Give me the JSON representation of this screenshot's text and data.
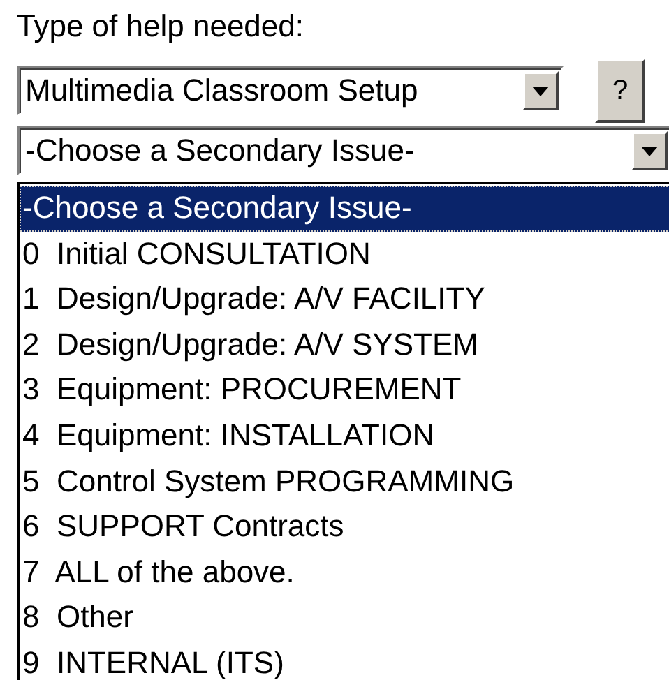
{
  "label": "Type of help needed:",
  "primary_select": {
    "value": "Multimedia Classroom Setup"
  },
  "help_button": {
    "label": "?"
  },
  "secondary_select": {
    "value": "-Choose a Secondary Issue-"
  },
  "options": [
    {
      "label": "-Choose a Secondary Issue-",
      "selected": true
    },
    {
      "label": "0  Initial CONSULTATION",
      "selected": false
    },
    {
      "label": "1  Design/Upgrade: A/V FACILITY",
      "selected": false
    },
    {
      "label": "2  Design/Upgrade: A/V SYSTEM",
      "selected": false
    },
    {
      "label": "3  Equipment: PROCUREMENT",
      "selected": false
    },
    {
      "label": "4  Equipment: INSTALLATION",
      "selected": false
    },
    {
      "label": "5  Control System PROGRAMMING",
      "selected": false
    },
    {
      "label": "6  SUPPORT Contracts",
      "selected": false
    },
    {
      "label": "7  ALL of the above.",
      "selected": false
    },
    {
      "label": "8  Other",
      "selected": false
    },
    {
      "label": "9  INTERNAL (ITS)",
      "selected": false
    }
  ]
}
